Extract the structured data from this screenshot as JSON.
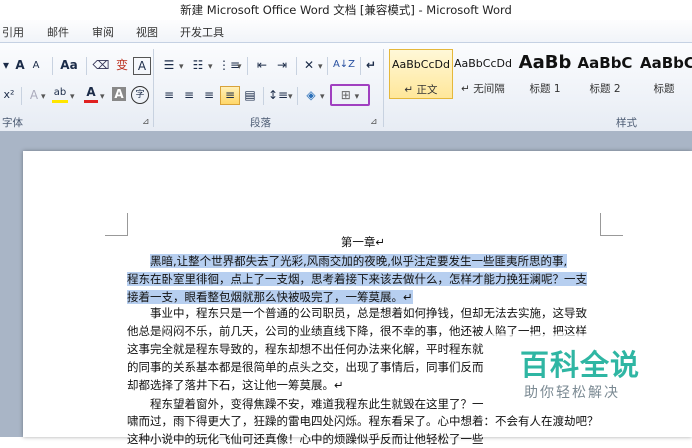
{
  "window": {
    "title": "新建 Microsoft Office Word 文档 [兼容模式] - Microsoft Word"
  },
  "menu": [
    "引用",
    "邮件",
    "审阅",
    "视图",
    "开发工具"
  ],
  "ribbon": {
    "font_group_label": "字体",
    "para_group_label": "段落",
    "styles_group_label": "样式",
    "grow_font": "A",
    "shrink_font": "A",
    "change_case": "Aa",
    "phonetic": "变",
    "char_border": "A",
    "superscript": "x²",
    "text_effect": "A",
    "highlight": "ab",
    "font_color": "A",
    "char_shading": "A",
    "enclose": "字",
    "sort": "A↓Z",
    "show_marks": "↵"
  },
  "styles": [
    {
      "preview": "AaBbCcDd",
      "name": "↵ 正文",
      "selected": true
    },
    {
      "preview": "AaBbCcDd",
      "name": "↵ 无间隔",
      "selected": false
    },
    {
      "preview": "AaBb",
      "name": "标题 1",
      "selected": false
    },
    {
      "preview": "AaBbC",
      "name": "标题 2",
      "selected": false
    },
    {
      "preview": "AaBbC",
      "name": "标题",
      "selected": false
    }
  ],
  "document": {
    "heading": "第一章↵",
    "lines": [
      {
        "text": "黑暗,让整个世界都失去了光彩,风雨交加的夜晚,似乎注定要发生一些匪夷所思的事,",
        "highlight": true,
        "indent": true
      },
      {
        "text": "程东在卧室里徘徊，点上了一支烟，思考着接下来该去做什么，怎样才能力挽狂澜呢？一支",
        "highlight": true,
        "indent": false
      },
      {
        "text": "接着一支，眼看整包烟就那么快被吸完了，一筹莫展。↵",
        "highlight": true,
        "indent": false
      },
      {
        "text": "事业中，程东只是一个普通的公司职员，总是想着如何挣钱，但却无法去实施，这导致",
        "highlight": false,
        "indent": true
      },
      {
        "text": "他总是闷闷不乐，前几天，公司的业绩直线下降，很不幸的事，他还被人陷了一把，把这样",
        "highlight": false,
        "indent": false
      },
      {
        "text": "这事完全就是程东导致的，程东却想不出任何办法来化解，平时程东就",
        "highlight": false,
        "indent": false
      },
      {
        "text": "的同事的关系基本都是很简单的点头之交，出现了事情后，同事们反而",
        "highlight": false,
        "indent": false
      },
      {
        "text": "却都选择了落井下石，这让他一筹莫展。↵",
        "highlight": false,
        "indent": false
      },
      {
        "text": "程东望着窗外，变得焦躁不安，难道我程东此生就毁在这里了？一",
        "highlight": false,
        "indent": true
      },
      {
        "text": "啸而过，雨下得更大了，狂躁的雷电四处闪烁。程东看呆了。心中想着：不会有人在渡劫吧？",
        "highlight": false,
        "indent": false
      },
      {
        "text": "这种小说中的玩化飞仙可还真像！心中的烦躁似乎反而让他轻松了一些",
        "highlight": false,
        "indent": false
      }
    ]
  },
  "watermark": {
    "title": "百科全说",
    "subtitle": "助你轻松解决"
  },
  "colors": {
    "highlight": "#b7cff0",
    "accent_border": "#a040c0",
    "watermark": "#2fb6a3"
  }
}
